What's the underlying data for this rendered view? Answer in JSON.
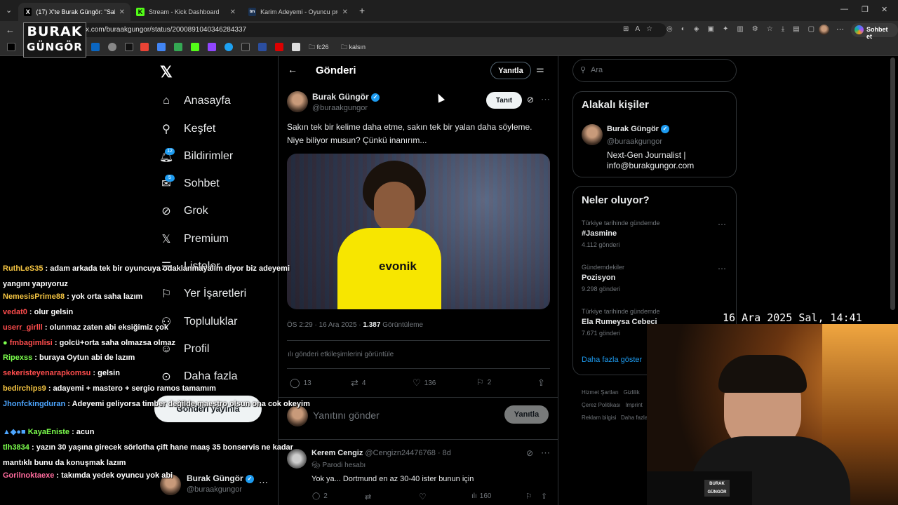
{
  "browser": {
    "tabs": [
      {
        "label": "(17) X'te Burak Güngör: \"Sakın tek",
        "icon": "x-icon"
      },
      {
        "label": "Stream - Kick Dashboard",
        "icon": "kick-icon"
      },
      {
        "label": "Karim Adeyemi - Oyuncu profili 2",
        "icon": "tm-icon"
      }
    ],
    "url": "x.com/buraakgungor/status/2000891040346284337",
    "chat_button": "Sohbet et",
    "bookmark_folders": [
      "fc26",
      "kalsın"
    ]
  },
  "stream_logo": {
    "line1": "BURAK",
    "line2": "GÜNGÖR"
  },
  "sidebar": {
    "items": [
      {
        "label": "Anasayfa",
        "icon": "home-icon"
      },
      {
        "label": "Keşfet",
        "icon": "search-icon"
      },
      {
        "label": "Bildirimler",
        "icon": "bell-icon",
        "badge": "12"
      },
      {
        "label": "Sohbet",
        "icon": "mail-icon",
        "badge": "5"
      },
      {
        "label": "Grok",
        "icon": "grok-icon"
      },
      {
        "label": "Premium",
        "icon": "x-icon"
      },
      {
        "label": "Listeler",
        "icon": "list-icon"
      },
      {
        "label": "Yer İşaretleri",
        "icon": "bookmark-icon"
      },
      {
        "label": "Topluluklar",
        "icon": "people-icon"
      },
      {
        "label": "Profil",
        "icon": "user-icon"
      },
      {
        "label": "Daha fazla",
        "icon": "more-icon"
      }
    ],
    "post_button": "Gönderi yayınla",
    "account": {
      "name": "Burak Güngör",
      "handle": "@buraakgungor"
    }
  },
  "post_header": {
    "title": "Gönderi",
    "reply_button": "Yanıtla"
  },
  "post": {
    "author": "Burak Güngör",
    "handle": "@buraakgungor",
    "follow_button": "Tanıt",
    "text": "Sakın tek bir kelime daha etme, sakın tek bir yalan daha söyleme. Niye biliyor musun? Çünkü inanırım...",
    "time": "ÖS 2:29 · 16 Ara 2025 · ",
    "views": "1.387",
    "views_label": " Görüntüleme",
    "engagements": "gönderi etkileşimlerini görüntüle",
    "stats": {
      "replies": "13",
      "reposts": "4",
      "likes": "136",
      "bookmarks": "2"
    },
    "sponsor_text": "evonik"
  },
  "reply_box": {
    "placeholder": "Yanıtını gönder",
    "button": "Yanıtla"
  },
  "reply": {
    "author": "Kerem Cengiz",
    "handle": "@Cengizn24476768",
    "time": "· 8d",
    "tag": "Parodi hesabı",
    "text": "Yok ya... Dortmund en az 30-40 ister bunun için",
    "stats": {
      "replies": "2",
      "views": "160"
    }
  },
  "search": {
    "placeholder": "Ara"
  },
  "related": {
    "title": "Alakalı kişiler",
    "name": "Burak Güngör",
    "handle": "@buraakgungor",
    "bio_line1": "Next-Gen Journalist |",
    "bio_line2": "info@burakgungor.com"
  },
  "trends": {
    "title": "Neler oluyor?",
    "items": [
      {
        "meta": "Türkiye tarihinde gündemde",
        "name": "#Jasmine",
        "count": "4.112 gönderi"
      },
      {
        "meta": "Gündemdekiler",
        "name": "Pozisyon",
        "count": "9.298 gönderi"
      },
      {
        "meta": "Türkiye tarihinde gündemde",
        "name": "Ela Rumeysa Cebeci",
        "count": "7.671 gönderi"
      }
    ],
    "show_more": "Daha fazla göster"
  },
  "footer_links": [
    "Hizmet Şartları",
    "Gizlilik",
    "Çerez Politikası",
    "Imprint",
    "Reklam bilgisi",
    "Daha fazla"
  ],
  "timestamp": "16 Ara 2025 Sal, 14:41",
  "chat": [
    {
      "user": "RuthLeS35",
      "color": "#f5c542",
      "msg": ": adam arkada tek bir oyuncuya odaklanmayalım diyor biz adeyemi yangını yapıyoruz"
    },
    {
      "user": "NemesisPrime88",
      "color": "#f5c542",
      "msg": ": yok orta saha lazım"
    },
    {
      "user": "vedat0",
      "color": "#ff4d4d",
      "msg": ": olur gelsin"
    },
    {
      "user": "userr_girlll",
      "color": "#ff4d4d",
      "msg": ": olunmaz zaten abi eksiğimiz çok"
    },
    {
      "user": "fmbagimlisi",
      "color": "#ff4d4d",
      "msg": ": golcü+orta saha olmazsa olmaz"
    },
    {
      "user": "Ripexss",
      "color": "#7cff4d",
      "msg": ": buraya Oytun abi de lazım"
    },
    {
      "user": "sekeristeyenarapkomsu",
      "color": "#ff4d4d",
      "msg": ": gelsin"
    },
    {
      "user": "bedirchips9",
      "color": "#f5c542",
      "msg": ": adayemi + mastero + sergio ramos tamamım"
    },
    {
      "user": "Jhonfckingduran",
      "color": "#4da6ff",
      "msg": ": Adeyemi geliyorsa timber değilde maestro olsun ona cok okeyim"
    },
    {
      "user": "KayaEniste",
      "color": "#7cff4d",
      "msg": ": acun"
    },
    {
      "user": "tlh3834",
      "color": "#7cff4d",
      "msg": ": yazın 30 yaşına girecek sörlotha çift hane maaş 35 bonservis ne kadar mantıklı bunu da konuşmak lazım"
    },
    {
      "user": "Gorilnoktaexe",
      "color": "#ff6b9d",
      "msg": ": takımda yedek oyuncu yok abi"
    }
  ]
}
